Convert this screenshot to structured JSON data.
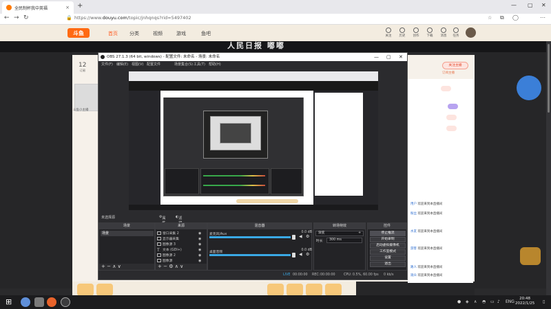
{
  "browser": {
    "tab_title": "全民制杯我中英福",
    "tab_close": "×",
    "new_tab": "+",
    "win_min": "—",
    "win_max": "▢",
    "win_close": "✕",
    "url_prefix": "https://www.",
    "url_domain": "douyu.com",
    "url_path": "/topic/jnhqnqs?rid=5497402"
  },
  "site": {
    "logo": "斗鱼",
    "nav": [
      "首页",
      "分类",
      "视频",
      "游戏",
      "鱼吧"
    ],
    "header_icons": [
      "关注",
      "历史",
      "创作",
      "下载",
      "消息",
      "任务",
      "开播"
    ],
    "banner_text": "人民日报 嘟嘟",
    "follow_count": "12",
    "follow_count_label": "订阅",
    "anchor_name": "斗鱼小主播",
    "follow_button": "关注主播",
    "follow_sub": "订阅主播",
    "chat": [
      {
        "user": "用户",
        "text": "欢迎来到本直播间"
      },
      {
        "user": "粉丝",
        "text": "欢迎来到本直播间"
      },
      {
        "user": "水友",
        "text": "欢迎来到本直播间"
      },
      {
        "user": "游客",
        "text": "欢迎来到本直播间"
      },
      {
        "user": "路人",
        "text": "欢迎来到本直播间"
      },
      {
        "user": "观众",
        "text": "欢迎来到本直播间"
      }
    ]
  },
  "obs": {
    "title": "OBS 27.1.3 (64 bit, windows) - 配置文件: 未命名 - 场景: 未命名",
    "menu": [
      "文件(F)",
      "编辑(E)",
      "视图(V)",
      "配置文件",
      "场景集合(S)",
      "工具(T)",
      "帮助(H)"
    ],
    "status_left": "未选择源",
    "status_btn1": "属性",
    "status_btn2": "滤镜",
    "docks": {
      "scenes_title": "场景",
      "sources_title": "来源",
      "mixer_title": "混音器",
      "transitions_title": "转场特效",
      "controls_title": "控件"
    },
    "scene": "场景",
    "sources": [
      "窗口采集 2",
      "显示器采集",
      "图像源 3",
      "文本 (GDI+)",
      "图像源 2",
      "图像源"
    ],
    "mixer": [
      {
        "name": "麦克风/Aux",
        "db": "0.0 dB"
      },
      {
        "name": "桌面音频",
        "db": "0.0 dB"
      }
    ],
    "transition_type": "渐变",
    "duration_label": "时长",
    "duration_value": "300 ms",
    "controls": [
      "停止推流",
      "开始录制",
      "启动虚拟摄像机",
      "工作室模式",
      "设置",
      "退出"
    ],
    "stats": {
      "live": "LIVE",
      "live_time": "00:00:00",
      "rec": "REC:",
      "rec_time": "00:00:00",
      "cpu": "CPU: 0.5%, 60.00 fps",
      "bitrate": "0 kb/s"
    }
  },
  "taskbar": {
    "lang": "ENG",
    "time": "20:48",
    "date": "2022/1/25"
  },
  "colors": {
    "brand": "#ff6a13",
    "obs_bg": "#2b2b2e",
    "accent_blue": "#3aa9e5"
  }
}
